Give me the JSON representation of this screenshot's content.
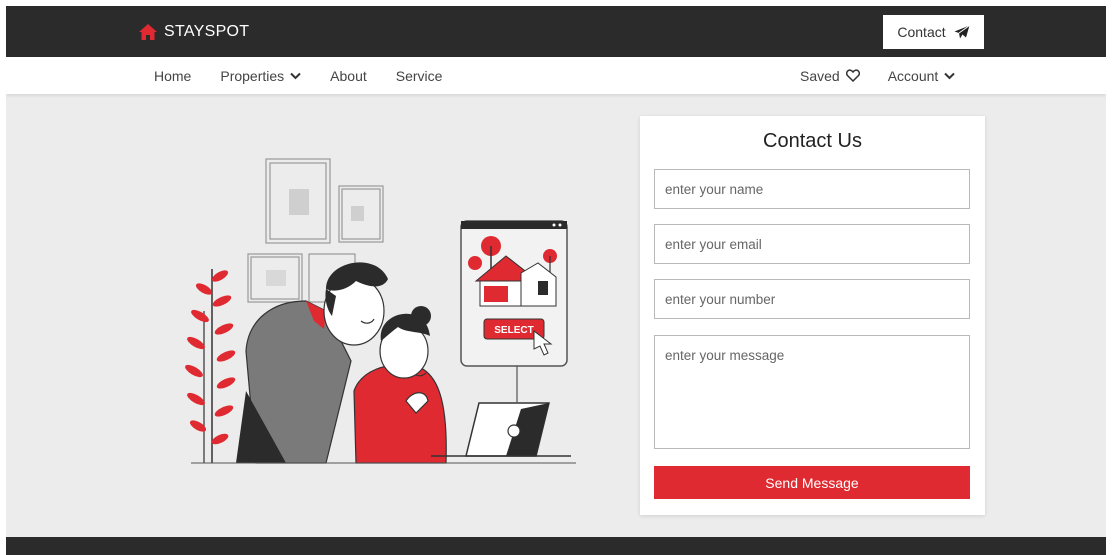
{
  "header": {
    "brand": "STAYSPOT",
    "contact_label": "Contact"
  },
  "nav": {
    "left": [
      {
        "label": "Home"
      },
      {
        "label": "Properties"
      },
      {
        "label": "About"
      },
      {
        "label": "Service"
      }
    ],
    "saved_label": "Saved",
    "account_label": "Account"
  },
  "illustration": {
    "select_label": "SELECT"
  },
  "form": {
    "title": "Contact Us",
    "name_placeholder": "enter your name",
    "email_placeholder": "enter your email",
    "number_placeholder": "enter your number",
    "message_placeholder": "enter your message",
    "send_label": "Send Message"
  },
  "colors": {
    "brand_red": "#e02a31",
    "dark_bar": "#2b2b2b",
    "page_bg": "#ececec"
  },
  "icons": {
    "brand": "house-icon",
    "contact": "paper-plane-icon",
    "properties": "chevron-down-icon",
    "saved": "heart-icon",
    "account": "chevron-down-icon"
  }
}
